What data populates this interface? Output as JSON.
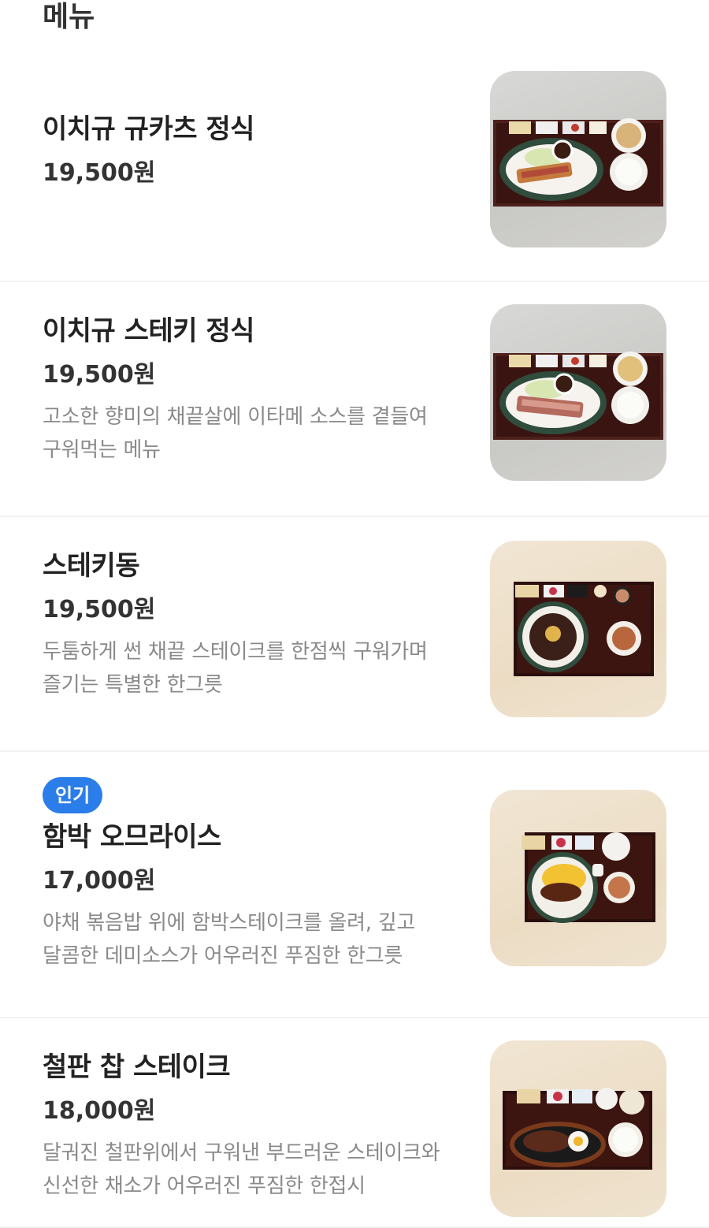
{
  "section": {
    "title": "메뉴"
  },
  "menu": [
    {
      "name": "이치규 규카츠 정식",
      "price": "19,500원",
      "desc_line1": "",
      "desc_line2": "",
      "image_icon": "gyukatsu-set-photo-icon"
    },
    {
      "name": "이치규 스테키 정식",
      "price": "19,500원",
      "desc_line1": "고소한 향미의 채끝살에 이타메 소스를 곁들여",
      "desc_line2": "구워먹는 메뉴",
      "image_icon": "steak-set-photo-icon"
    },
    {
      "name": "스테키동",
      "price": "19,500원",
      "desc_line1": "두툼하게 썬 채끝 스테이크를 한점씩 구워가며",
      "desc_line2": "즐기는 특별한 한그릇",
      "image_icon": "steak-don-photo-icon"
    },
    {
      "badge": "인기",
      "name": "함박 오므라이스",
      "price": "17,000원",
      "desc_line1": "야채 볶음밥 위에 함박스테이크를 올려, 깊고",
      "desc_line2": "달콤한 데미소스가 어우러진 푸짐한 한그릇",
      "image_icon": "hamburg-omurice-photo-icon"
    },
    {
      "name": "철판 찹 스테이크",
      "price": "18,000원",
      "desc_line1": "달궈진 철판위에서 구워낸 부드러운 스테이크와",
      "desc_line2": "신선한 채소가 어우러진 푸짐한 한접시",
      "image_icon": "iron-plate-steak-photo-icon"
    }
  ],
  "colors": {
    "badge": "#2b7de9",
    "title": "#222222",
    "desc": "#8a8a8a",
    "divider": "#f2f2f2"
  }
}
